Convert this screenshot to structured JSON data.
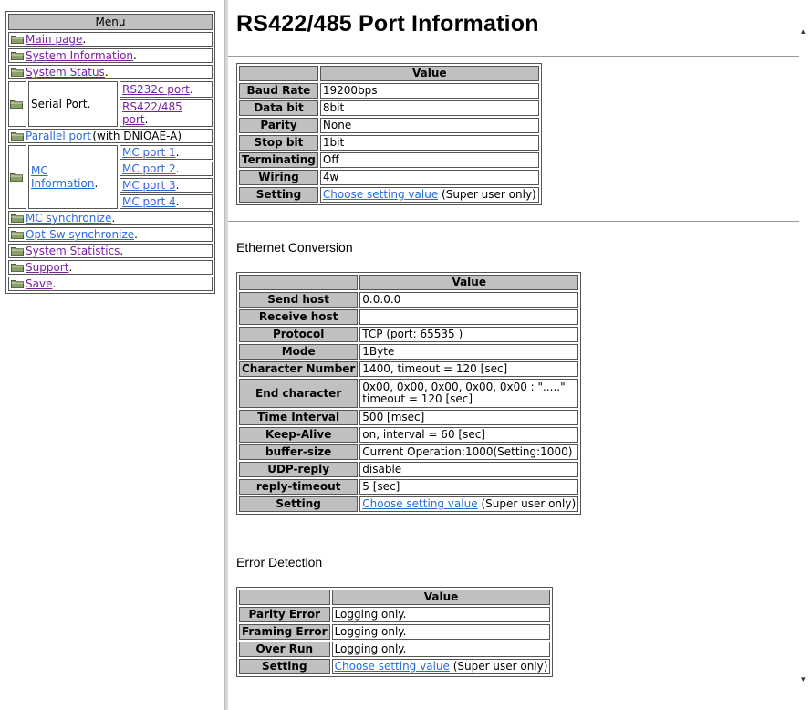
{
  "menu": {
    "header": "Menu",
    "main_page": "Main page",
    "system_information": "System Information",
    "system_status": "System Status",
    "serial_port": "Serial Port",
    "rs232c_port": "RS232c port",
    "rs422_485_port_line1": "RS422/485",
    "rs422_485_port_line2": "port",
    "parallel_port": "Parallel port",
    "parallel_port_suffix": "(with DNIOAE-A)",
    "mc_information_line1": "MC",
    "mc_information_line2": "Information",
    "mc_port_1": "MC port 1",
    "mc_port_2": "MC port 2",
    "mc_port_3": "MC port 3",
    "mc_port_4": "MC port 4",
    "mc_synchronize": "MC synchronize",
    "opt_sw_synchronize": "Opt-Sw synchronize",
    "system_statistics": "System Statistics",
    "support": "Support",
    "save": "Save",
    "dot": "."
  },
  "page": {
    "title": "RS422/485 Port Information"
  },
  "port_table": {
    "value_header": "Value",
    "rows": [
      {
        "label": "Baud Rate",
        "value": "19200bps"
      },
      {
        "label": "Data bit",
        "value": "8bit"
      },
      {
        "label": "Parity",
        "value": "None"
      },
      {
        "label": "Stop bit",
        "value": "1bit"
      },
      {
        "label": "Terminating",
        "value": "Off"
      },
      {
        "label": "Wiring",
        "value": "4w"
      }
    ],
    "setting_label": "Setting",
    "setting_link": "Choose setting value",
    "setting_note": "(Super user only)"
  },
  "ethernet": {
    "title": "Ethernet Conversion",
    "value_header": "Value",
    "rows": [
      {
        "label": "Send host",
        "value": "0.0.0.0"
      },
      {
        "label": "Receive host",
        "value": ""
      },
      {
        "label": "Protocol",
        "value": "TCP (port: 65535 )"
      },
      {
        "label": "Mode",
        "value": "1Byte"
      },
      {
        "label": "Character Number",
        "value": "1400, timeout = 120 [sec]"
      },
      {
        "label": "End character",
        "value": "0x00, 0x00, 0x00, 0x00, 0x00 : \".....\"",
        "value2": "timeout = 120 [sec]"
      },
      {
        "label": "Time Interval",
        "value": "500 [msec]"
      },
      {
        "label": "Keep-Alive",
        "value": "on, interval = 60 [sec]"
      },
      {
        "label": "buffer-size",
        "value": "Current Operation:1000(Setting:1000)"
      },
      {
        "label": "UDP-reply",
        "value": "disable"
      },
      {
        "label": "reply-timeout",
        "value": "5 [sec]"
      }
    ],
    "setting_label": "Setting",
    "setting_link": "Choose setting value",
    "setting_note": "(Super user only)"
  },
  "errors": {
    "title": "Error Detection",
    "value_header": "Value",
    "rows": [
      {
        "label": "Parity Error",
        "value": "Logging only."
      },
      {
        "label": "Framing Error",
        "value": "Logging only."
      },
      {
        "label": "Over Run",
        "value": "Logging only."
      }
    ],
    "setting_label": "Setting",
    "setting_link": "Choose setting value",
    "setting_note": "(Super user only)"
  },
  "colors": {
    "header_gray": "#c0c0c0",
    "visited_link": "#7a1fa2",
    "link": "#2b6bd6",
    "folder_icon": "#8aa06a"
  }
}
